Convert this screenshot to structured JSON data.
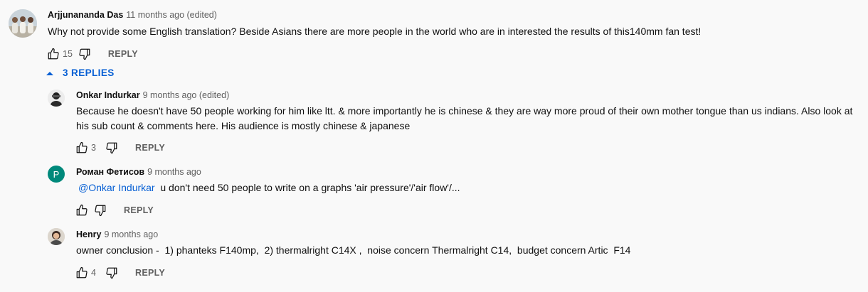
{
  "top_comment": {
    "author": "Arjjunananda Das",
    "meta": "11 months ago (edited)",
    "text": "Why not provide some English translation? Beside Asians there are more people in the world who are in interested the results of this140mm fan test!",
    "likes": "15",
    "reply_label": "REPLY"
  },
  "replies_toggle": {
    "label": "3 REPLIES",
    "icon": "caret-up-icon"
  },
  "replies": [
    {
      "author": "Onkar Indurkar",
      "meta": "9 months ago (edited)",
      "text": "Because he doesn't have 50 people working for him like ltt. & more importantly he is chinese & they are way more proud of their own mother tongue than us indians. Also look at his sub count & comments here. His audience is mostly chinese & japanese",
      "likes": "3",
      "reply_label": "REPLY"
    },
    {
      "author": "Роман Фетисов",
      "avatar_letter": "Р",
      "avatar_color": "#00897b",
      "meta": "9 months ago",
      "mention": "@Onkar Indurkar",
      "text": "u don't need 50 people to write on a graphs 'air pressure'/'air flow'/...",
      "likes": "",
      "reply_label": "REPLY"
    },
    {
      "author": "Henry",
      "meta": "9 months ago",
      "text": "owner conclusion -  1) phanteks F140mp,  2) thermalright C14X ,  noise concern Thermalright C14,  budget concern Artic  F14",
      "likes": "4",
      "reply_label": "REPLY"
    }
  ],
  "colors": {
    "link_blue": "#065fd4",
    "secondary_text": "#606060",
    "background": "#f9f9f9"
  }
}
